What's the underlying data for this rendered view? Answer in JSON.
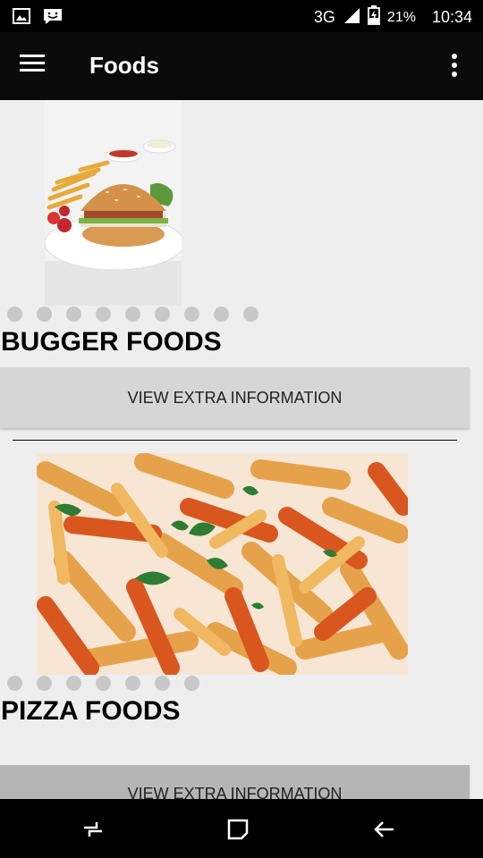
{
  "status_bar": {
    "network": "3G",
    "battery": "21%",
    "time": "10:34",
    "icons": [
      "image-icon",
      "messenger-icon",
      "signal-icon",
      "battery-charging-icon"
    ]
  },
  "app_bar": {
    "title": "Foods",
    "icons": [
      "hamburger-menu-icon",
      "overflow-menu-icon"
    ]
  },
  "items": [
    {
      "title": "BUGGER FOODS",
      "button_label": "VIEW EXTRA INFORMATION",
      "image": "burger-photo",
      "dots_count": 9
    },
    {
      "title": "PIZZA FOODS",
      "button_label": "VIEW EXTRA INFORMATION",
      "image": "penne-pasta-photo",
      "dots_count": 7
    }
  ],
  "nav_bar": {
    "icons": [
      "recent-apps-icon",
      "home-icon",
      "back-icon"
    ]
  }
}
